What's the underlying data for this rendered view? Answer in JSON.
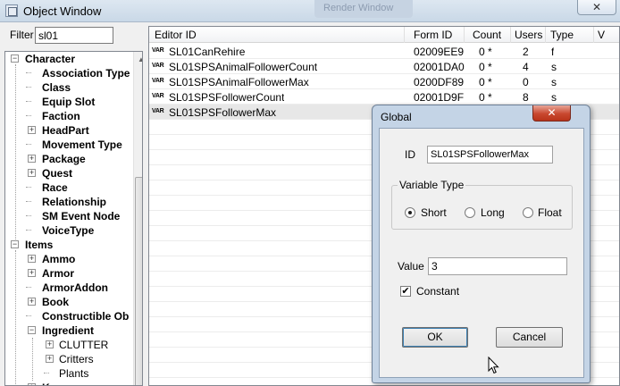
{
  "window": {
    "title": "Object Window",
    "background_title": "Render Window",
    "close_label": "✕"
  },
  "filter": {
    "label": "Filter",
    "value": "sl01"
  },
  "tree": [
    {
      "label": "Character",
      "exp": "−",
      "level": 0
    },
    {
      "label": "Association Type",
      "level": 1
    },
    {
      "label": "Class",
      "level": 1
    },
    {
      "label": "Equip Slot",
      "level": 1
    },
    {
      "label": "Faction",
      "level": 1
    },
    {
      "label": "HeadPart",
      "exp": "+",
      "level": 1
    },
    {
      "label": "Movement Type",
      "level": 1
    },
    {
      "label": "Package",
      "exp": "+",
      "level": 1
    },
    {
      "label": "Quest",
      "exp": "+",
      "level": 1
    },
    {
      "label": "Race",
      "level": 1
    },
    {
      "label": "Relationship",
      "level": 1
    },
    {
      "label": "SM Event Node",
      "level": 1
    },
    {
      "label": "VoiceType",
      "level": 1
    },
    {
      "label": "Items",
      "exp": "−",
      "level": 0
    },
    {
      "label": "Ammo",
      "exp": "+",
      "level": 1
    },
    {
      "label": "Armor",
      "exp": "+",
      "level": 1
    },
    {
      "label": "ArmorAddon",
      "level": 1
    },
    {
      "label": "Book",
      "exp": "+",
      "level": 1
    },
    {
      "label": "Constructible Ob",
      "level": 1
    },
    {
      "label": "Ingredient",
      "exp": "−",
      "level": 1
    },
    {
      "label": "CLUTTER",
      "exp": "+",
      "level": 2
    },
    {
      "label": "Critters",
      "exp": "+",
      "level": 2
    },
    {
      "label": "Plants",
      "level": 2
    },
    {
      "label": "Key",
      "exp": "+",
      "level": 1
    }
  ],
  "list": {
    "columns": [
      "Editor ID",
      "Form ID",
      "Count",
      "Users",
      "Type",
      "V"
    ],
    "rows": [
      {
        "editor_id": "SL01CanRehire",
        "form_id": "02009EE9",
        "count": "0 *",
        "users": "2",
        "type": "f"
      },
      {
        "editor_id": "SL01SPSAnimalFollowerCount",
        "form_id": "02001DA0",
        "count": "0 *",
        "users": "4",
        "type": "s"
      },
      {
        "editor_id": "SL01SPSAnimalFollowerMax",
        "form_id": "0200DF89",
        "count": "0 *",
        "users": "0",
        "type": "s"
      },
      {
        "editor_id": "SL01SPSFollowerCount",
        "form_id": "02001D9F",
        "count": "0 *",
        "users": "8",
        "type": "s"
      },
      {
        "editor_id": "SL01SPSFollowerMax",
        "form_id": "",
        "count": "",
        "users": "",
        "type": ""
      }
    ],
    "var_icon_text": "VAR"
  },
  "dialog": {
    "title": "Global",
    "close_label": "✕",
    "id_label": "ID",
    "id_value": "SL01SPSFollowerMax",
    "variable_type_label": "Variable Type",
    "options": [
      "Short",
      "Long",
      "Float"
    ],
    "selected_option": "Short",
    "value_label": "Value",
    "value": "3",
    "constant_label": "Constant",
    "constant_checked": true,
    "constant_mark": "✔",
    "ok_label": "OK",
    "cancel_label": "Cancel"
  }
}
